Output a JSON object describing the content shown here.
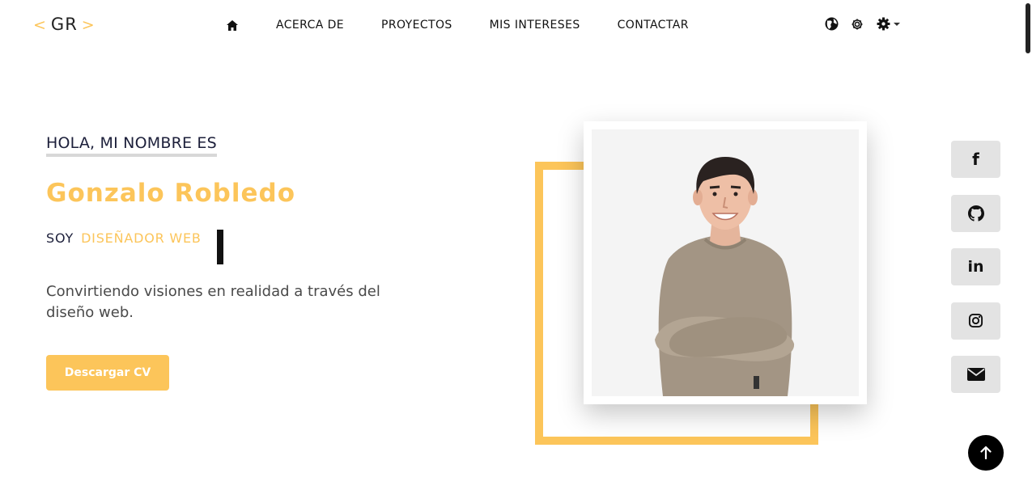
{
  "brand": {
    "open": "<",
    "initials": "GR",
    "close": ">"
  },
  "nav": {
    "home_icon": "home-icon",
    "links": [
      "ACERCA DE",
      "PROYECTOS",
      "MIS INTERESES",
      "CONTACTAR"
    ],
    "tools": [
      "globe-icon",
      "gear-icon",
      "settings-dropdown-icon"
    ]
  },
  "hero": {
    "greeting": "HOLA, MI NOMBRE ES",
    "name": "Gonzalo Robledo",
    "role_prefix": "SOY",
    "role_value": "DISEÑADOR WEB",
    "tagline": "Convirtiendo visiones en realidad a través del diseño web.",
    "cv_button": "Descargar CV"
  },
  "social": {
    "facebook": "f",
    "linkedin": "in",
    "icons": [
      "facebook-icon",
      "github-icon",
      "linkedin-icon",
      "instagram-icon",
      "email-icon"
    ]
  },
  "colors": {
    "accent": "#fcc55a",
    "dark_text": "#1c1f3a",
    "social_bg": "#e3e3e3"
  }
}
